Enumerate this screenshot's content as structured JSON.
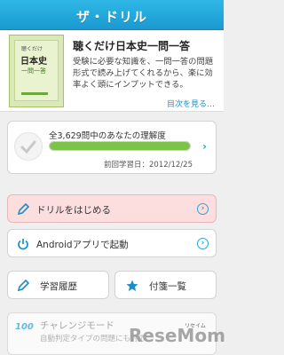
{
  "header": {
    "title": "ザ・ドリル"
  },
  "book": {
    "cover_line1": "聴くだけ",
    "cover_line2": "日本史",
    "cover_line3": "一問一答",
    "title": "聴くだけ日本史一問一答",
    "description": "受験に必要な知識を、一問一答の問題形式で読み上げてくれるから、楽に効率よく頭にインプットできる。",
    "toc_link": "目次を見る…"
  },
  "progress": {
    "label": "全3,629問中のあなたの理解度",
    "fill_percent": 100,
    "last_date": "前回学習日：2012/12/25"
  },
  "buttons": {
    "start": "ドリルをはじめる",
    "android": "Androidアプリで起動",
    "history": "学習履歴",
    "sticky": "付箋一覧"
  },
  "challenge": {
    "title": "チャレンジモード",
    "sub": "自動判定タイプの問題にも対応",
    "badge": "100",
    "tag": "リセイム"
  },
  "watermark": "ResеMom",
  "colors": {
    "accent": "#2aa3d8",
    "header": "#1fa6dc",
    "start_bg": "#fcdede",
    "progress": "#7cc34a"
  }
}
